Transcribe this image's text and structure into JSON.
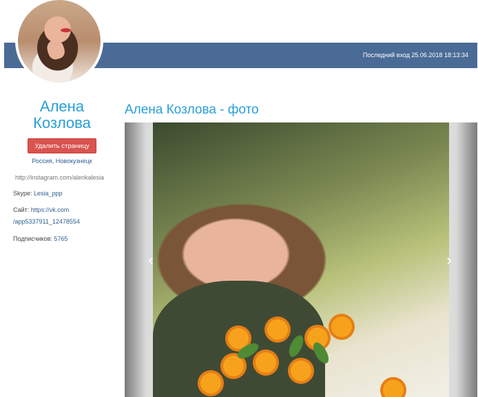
{
  "header": {
    "last_login": "Последний вход 25.06.2018 18:13:34"
  },
  "profile": {
    "name_line1": "Алена",
    "name_line2": "Козлова",
    "delete_button": "Удалить страницу",
    "location": "Россия, Новокузнецк",
    "instagram": "http://instagram.com/alenkalesia",
    "skype_label": "Skype: ",
    "skype_value": "Lesia_ppp",
    "site_label": "Сайт: ",
    "site_value_line1": "https://vk.com",
    "site_value_line2": "/app5337911_12478554",
    "subscribers_label": "Подписчиков: ",
    "subscribers_value": "5765"
  },
  "main": {
    "photo_title": "Алена Козлова - фото",
    "prev_arrow": "‹",
    "next_arrow": "›"
  },
  "icons": [
    "avatar",
    "chevron-left-icon",
    "chevron-right-icon"
  ]
}
